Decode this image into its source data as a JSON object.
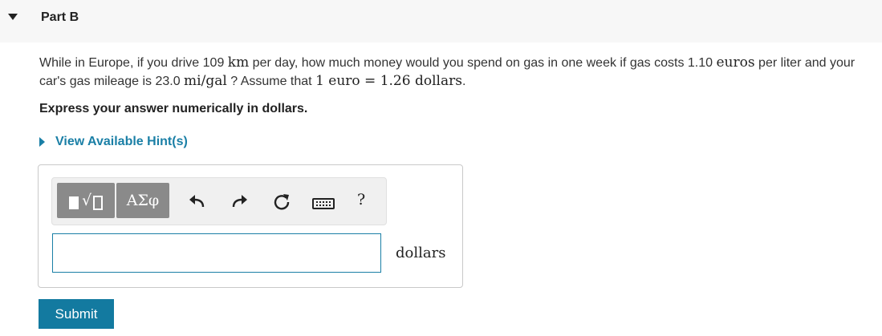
{
  "part": {
    "title": "Part B"
  },
  "question": {
    "t1": "While in Europe, if you drive 109 ",
    "m1": "km",
    "t2": " per day, how much money would you spend on gas in one week if gas costs 1.10 ",
    "m2": "euros",
    "t3": " per liter and your car's gas mileage is 23.0 ",
    "m3": "mi/gal",
    "t4": " ? Assume that ",
    "m4": "1 euro = 1.26 dollars",
    "t5": "."
  },
  "instruction": "Express your answer numerically in dollars.",
  "hint": {
    "label": "View Available Hint(s)"
  },
  "toolbar": {
    "greek_label": "ΑΣφ",
    "help_label": "?"
  },
  "answer": {
    "value": "",
    "unit": "dollars"
  },
  "submit": {
    "label": "Submit"
  },
  "colors": {
    "accent": "#137aa0",
    "link": "#1a7fa6",
    "toolbar_button": "#8a8a8a"
  }
}
